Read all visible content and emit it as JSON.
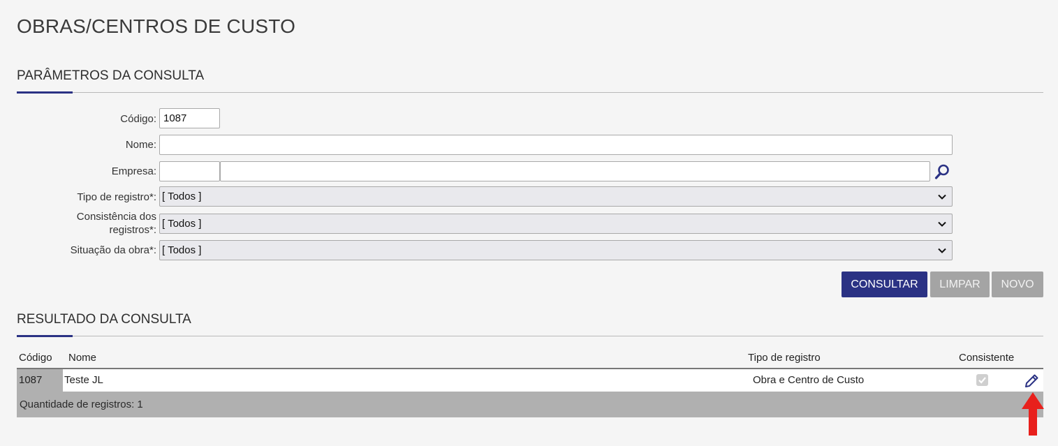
{
  "page": {
    "title": "OBRAS/CENTROS DE CUSTO"
  },
  "params_section": {
    "title": "PARÂMETROS DA CONSULTA",
    "fields": {
      "codigo": {
        "label": "Código:",
        "value": "1087"
      },
      "nome": {
        "label": "Nome:",
        "value": ""
      },
      "empresa": {
        "label": "Empresa:",
        "code_value": "",
        "name_value": ""
      },
      "tipo_registro": {
        "label": "Tipo de registro*:",
        "selected": "[ Todos ]"
      },
      "consistencia": {
        "label_line1": "Consistência dos",
        "label_line2": "registros*:",
        "selected": "[ Todos ]"
      },
      "situacao": {
        "label": "Situação da obra*:",
        "selected": "[ Todos ]"
      }
    },
    "buttons": {
      "consultar": "CONSULTAR",
      "limpar": "LIMPAR",
      "novo": "NOVO"
    }
  },
  "results_section": {
    "title": "RESULTADO DA CONSULTA",
    "columns": {
      "codigo": "Código",
      "nome": "Nome",
      "tipo_registro": "Tipo de registro",
      "consistente": "Consistente"
    },
    "rows": [
      {
        "codigo": "1087",
        "nome": "Teste JL",
        "tipo_registro": "Obra e Centro de Custo",
        "consistente": true
      }
    ],
    "footer": "Quantidade de registros: 1"
  },
  "icons": {
    "lookup": "magnifier-icon",
    "dropdown": "chevron-down-icon",
    "check": "checkmark-icon",
    "edit": "pencil-icon",
    "annotation": "red-arrow-up-icon"
  },
  "colors": {
    "primary": "#2b3284",
    "disabled": "#a4a4a4",
    "annotation": "#e8201c"
  }
}
